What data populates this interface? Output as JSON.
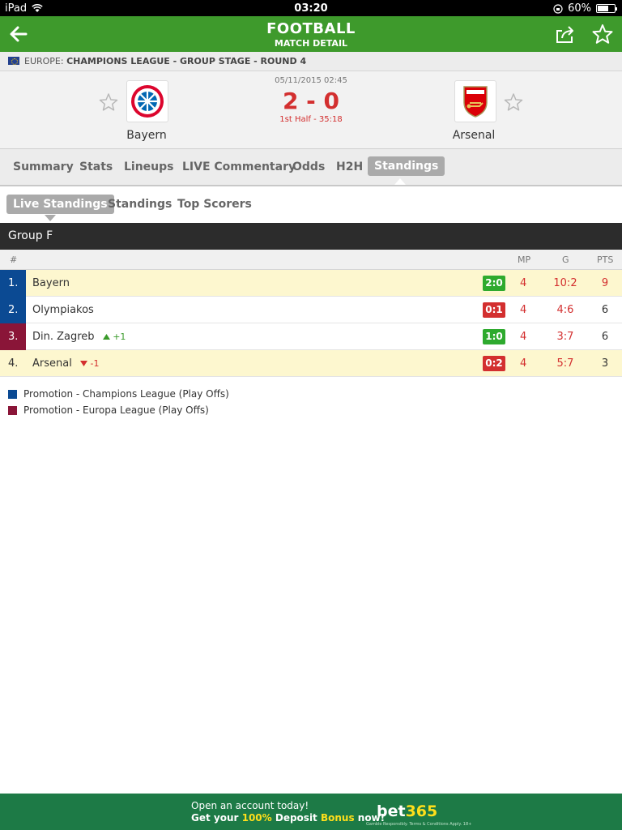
{
  "status_bar": {
    "device": "iPad",
    "time": "03:20",
    "battery": "60%"
  },
  "header": {
    "title": "FOOTBALL",
    "subtitle": "MATCH DETAIL"
  },
  "breadcrumb": {
    "region": "EUROPE:",
    "competition": "CHAMPIONS LEAGUE - GROUP STAGE - ROUND 4"
  },
  "match": {
    "date": "05/11/2015 02:45",
    "score": "2 - 0",
    "status": "1st Half - 35:18",
    "home": {
      "name": "Bayern"
    },
    "away": {
      "name": "Arsenal"
    }
  },
  "tabs": [
    "Summary",
    "Stats",
    "Lineups",
    "LIVE Commentary",
    "Odds",
    "H2H",
    "Standings"
  ],
  "active_tab": "Standings",
  "subtabs": [
    "Live Standings",
    "Standings",
    "Top Scorers"
  ],
  "active_subtab": "Live Standings",
  "group": {
    "name": "Group F"
  },
  "columns": {
    "rank": "#",
    "mp": "MP",
    "g": "G",
    "pts": "PTS"
  },
  "standings": [
    {
      "rank": "1.",
      "team": "Bayern",
      "movement": "",
      "result": "2:0",
      "mp": "4",
      "g": "10:2",
      "pts": "9"
    },
    {
      "rank": "2.",
      "team": "Olympiakos",
      "movement": "",
      "result": "0:1",
      "mp": "4",
      "g": "4:6",
      "pts": "6"
    },
    {
      "rank": "3.",
      "team": "Din. Zagreb",
      "movement": "+1",
      "result": "1:0",
      "mp": "4",
      "g": "3:7",
      "pts": "6"
    },
    {
      "rank": "4.",
      "team": "Arsenal",
      "movement": "-1",
      "result": "0:2",
      "mp": "4",
      "g": "5:7",
      "pts": "3"
    }
  ],
  "legend": [
    {
      "label": "Promotion - Champions League (Play Offs)",
      "color": "#0b4a93"
    },
    {
      "label": "Promotion - Europa League (Play Offs)",
      "color": "#8a1538"
    }
  ],
  "ad": {
    "line1": "Open an account today!",
    "line2_a": "Get your ",
    "line2_b": "100%",
    "line2_c": " Deposit ",
    "line2_d": "Bonus",
    "line2_e": " now!",
    "logo_a": "bet",
    "logo_b": "365",
    "fine_print": "Gamble Responsibly. Terms & Conditions Apply. 18+"
  },
  "colors": {
    "header_green": "#3e9a2c",
    "win": "#2eaa2e",
    "loss": "#d32f2f",
    "score_red": "#d32f2f"
  }
}
